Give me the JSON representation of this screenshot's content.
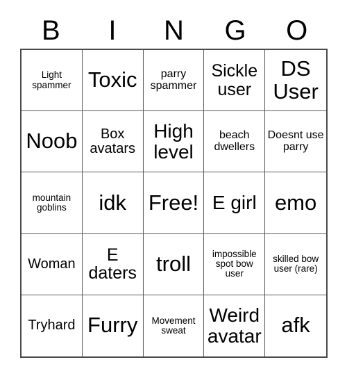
{
  "card": {
    "headers": [
      "B",
      "I",
      "N",
      "G",
      "O"
    ],
    "rows": [
      [
        {
          "text": "Light spammer",
          "size": "xs"
        },
        {
          "text": "Toxic",
          "size": "xxl"
        },
        {
          "text": "parry spammer",
          "size": "sm"
        },
        {
          "text": "Sickle user",
          "size": "lg"
        },
        {
          "text": "DS User",
          "size": "xxl"
        }
      ],
      [
        {
          "text": "Noob",
          "size": "xxl"
        },
        {
          "text": "Box avatars",
          "size": "md"
        },
        {
          "text": "High level",
          "size": "xl"
        },
        {
          "text": "beach dwellers",
          "size": "sm"
        },
        {
          "text": "Doesnt use parry",
          "size": "sm"
        }
      ],
      [
        {
          "text": "mountain goblins",
          "size": "xs"
        },
        {
          "text": "idk",
          "size": "xxl"
        },
        {
          "text": "Free!",
          "size": "xxl"
        },
        {
          "text": "E girl",
          "size": "xl"
        },
        {
          "text": "emo",
          "size": "xxl"
        }
      ],
      [
        {
          "text": "Woman",
          "size": "md"
        },
        {
          "text": "E daters",
          "size": "lg"
        },
        {
          "text": "troll",
          "size": "xxl"
        },
        {
          "text": "impossible spot bow user",
          "size": "xs"
        },
        {
          "text": "skilled bow user (rare)",
          "size": "xs"
        }
      ],
      [
        {
          "text": "Tryhard",
          "size": "md"
        },
        {
          "text": "Furry",
          "size": "xxl"
        },
        {
          "text": "Movement sweat",
          "size": "xs"
        },
        {
          "text": "Weird avatar",
          "size": "xl"
        },
        {
          "text": "afk",
          "size": "xxl"
        }
      ]
    ],
    "colors": {
      "background": "#ffffff",
      "text": "#000000",
      "outer_border": "#4a4a4a",
      "inner_border": "#5a5a5a"
    }
  }
}
